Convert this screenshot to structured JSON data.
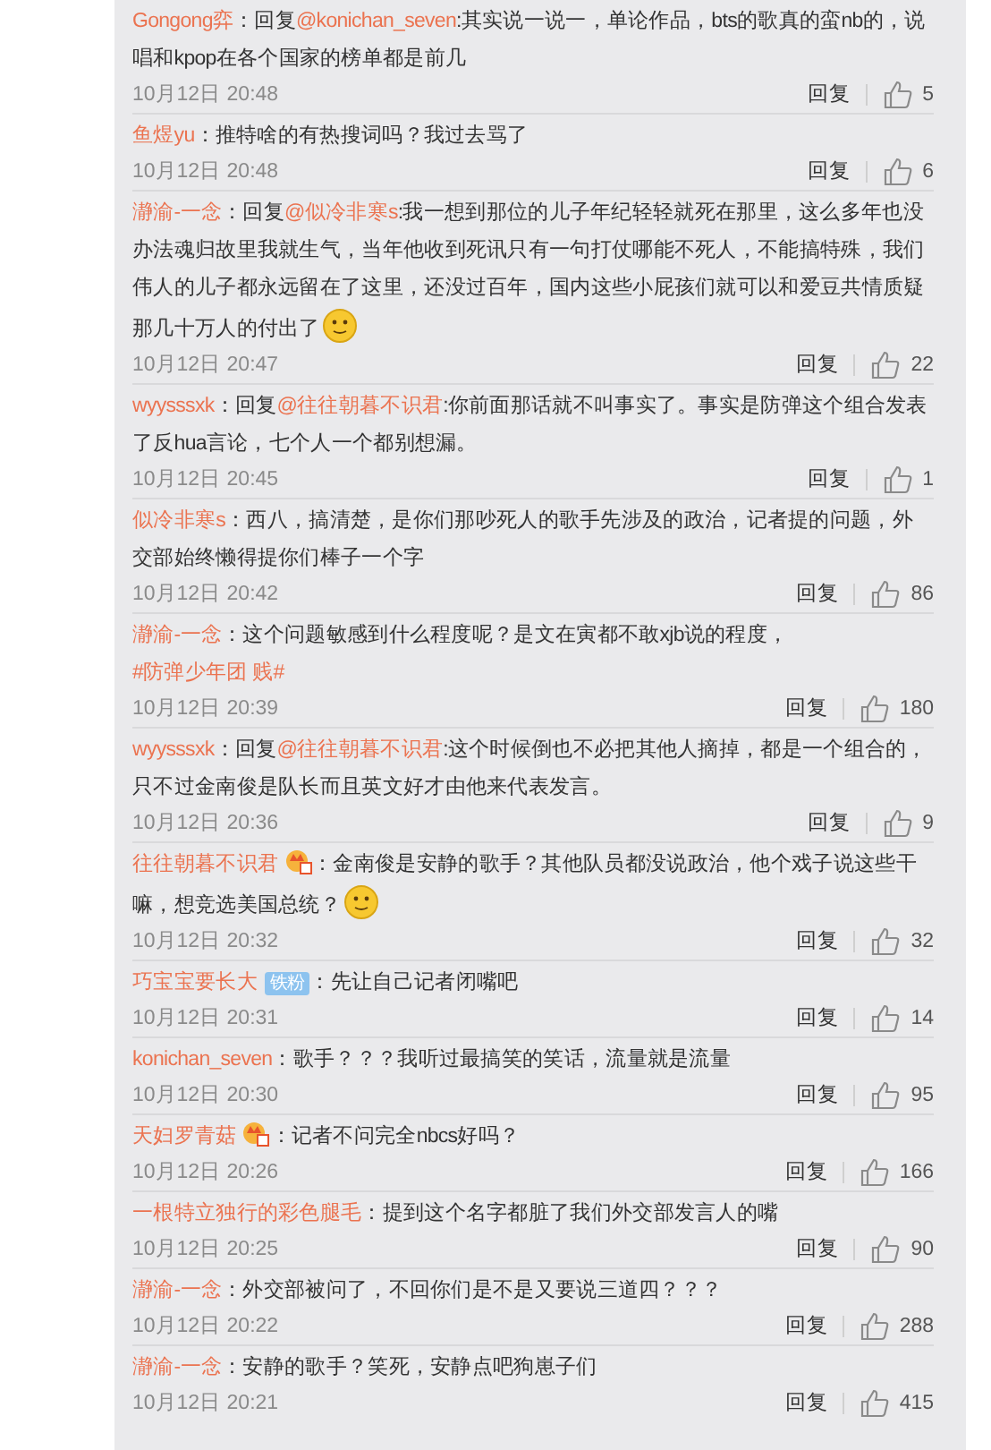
{
  "comments": [
    {
      "user": "Gongong弈",
      "body": [
        {
          "kind": "text",
          "text": "：回复"
        },
        {
          "kind": "mention",
          "text": "@konichan_seven"
        },
        {
          "kind": "text",
          "text": ":其实说一说一，单论作品，bts的歌真的蛮nb的，说唱和kpop在各个国家的榜单都是前几"
        }
      ],
      "time": "10月12日 20:48",
      "reply": "回复",
      "likes": "5"
    },
    {
      "user": "鱼煜yu",
      "body": [
        {
          "kind": "text",
          "text": "：推特啥的有热搜词吗？我过去骂了"
        }
      ],
      "time": "10月12日 20:48",
      "reply": "回复",
      "likes": "6"
    },
    {
      "user": "瀞渝-一念",
      "body": [
        {
          "kind": "text",
          "text": "：回复"
        },
        {
          "kind": "mention",
          "text": "@似冷非寒s"
        },
        {
          "kind": "text",
          "text": ":我一想到那位的儿子年纪轻轻就死在那里，这么多年也没办法魂归故里我就生气，当年他收到死讯只有一句打仗哪能不死人，不能搞特殊，我们伟人的儿子都永远留在了这里，还没过百年，国内这些小屁孩们就可以和爱豆共情质疑那几十万人的付出了"
        },
        {
          "kind": "emoji"
        }
      ],
      "time": "10月12日 20:47",
      "reply": "回复",
      "likes": "22"
    },
    {
      "user": "wyysssxk",
      "body": [
        {
          "kind": "text",
          "text": "：回复"
        },
        {
          "kind": "mention",
          "text": "@往往朝暮不识君"
        },
        {
          "kind": "text",
          "text": ":你前面那话就不叫事实了。事实是防弹这个组合发表了反hua言论，七个人一个都别想漏。"
        }
      ],
      "time": "10月12日 20:45",
      "reply": "回复",
      "likes": "1"
    },
    {
      "user": "似冷非寒s",
      "body": [
        {
          "kind": "text",
          "text": "：西八，搞清楚，是你们那吵死人的歌手先涉及的政治，记者提的问题，外交部始终懒得提你们棒子一个字"
        }
      ],
      "time": "10月12日 20:42",
      "reply": "回复",
      "likes": "86"
    },
    {
      "user": "瀞渝-一念",
      "body": [
        {
          "kind": "text",
          "text": "：这个问题敏感到什么程度呢？是文在寅都不敢xjb说的程度，"
        },
        {
          "kind": "hashtag",
          "text": "#防弹少年团  贱#"
        }
      ],
      "time": "10月12日 20:39",
      "reply": "回复",
      "likes": "180"
    },
    {
      "user": "wyysssxk",
      "body": [
        {
          "kind": "text",
          "text": "：回复"
        },
        {
          "kind": "mention",
          "text": "@往往朝暮不识君"
        },
        {
          "kind": "text",
          "text": ":这个时候倒也不必把其他人摘掉，都是一个组合的，只不过金南俊是队长而且英文好才由他来代表发言。"
        }
      ],
      "time": "10月12日 20:36",
      "reply": "回复",
      "likes": "9"
    },
    {
      "user": "往往朝暮不识君",
      "badge": {
        "kind": "icon"
      },
      "body": [
        {
          "kind": "text",
          "text": "：金南俊是安静的歌手？其他队员都没说政治，他个戏子说这些干嘛，想竞选美国总统？"
        },
        {
          "kind": "emoji"
        }
      ],
      "time": "10月12日 20:32",
      "reply": "回复",
      "likes": "32"
    },
    {
      "user": "巧宝宝要长大",
      "badge": {
        "kind": "label",
        "text": "铁粉"
      },
      "body": [
        {
          "kind": "text",
          "text": "：先让自己记者闭嘴吧"
        }
      ],
      "time": "10月12日 20:31",
      "reply": "回复",
      "likes": "14"
    },
    {
      "user": "konichan_seven",
      "body": [
        {
          "kind": "text",
          "text": "：歌手？？？我听过最搞笑的笑话，流量就是流量"
        }
      ],
      "time": "10月12日 20:30",
      "reply": "回复",
      "likes": "95"
    },
    {
      "user": "天妇罗青菇",
      "badge": {
        "kind": "icon"
      },
      "body": [
        {
          "kind": "text",
          "text": "：记者不问完全nbcs好吗？"
        }
      ],
      "time": "10月12日 20:26",
      "reply": "回复",
      "likes": "166"
    },
    {
      "user": "一根特立独行的彩色腿毛",
      "body": [
        {
          "kind": "text",
          "text": "：提到这个名字都脏了我们外交部发言人的嘴"
        }
      ],
      "time": "10月12日 20:25",
      "reply": "回复",
      "likes": "90"
    },
    {
      "user": "瀞渝-一念",
      "body": [
        {
          "kind": "text",
          "text": "：外交部被问了，不回你们是不是又要说三道四？？？"
        }
      ],
      "time": "10月12日 20:22",
      "reply": "回复",
      "likes": "288"
    },
    {
      "user": "瀞渝-一念",
      "body": [
        {
          "kind": "text",
          "text": "：安静的歌手？笑死，安静点吧狗崽子们"
        }
      ],
      "time": "10月12日 20:21",
      "reply": "回复",
      "likes": "415"
    }
  ]
}
